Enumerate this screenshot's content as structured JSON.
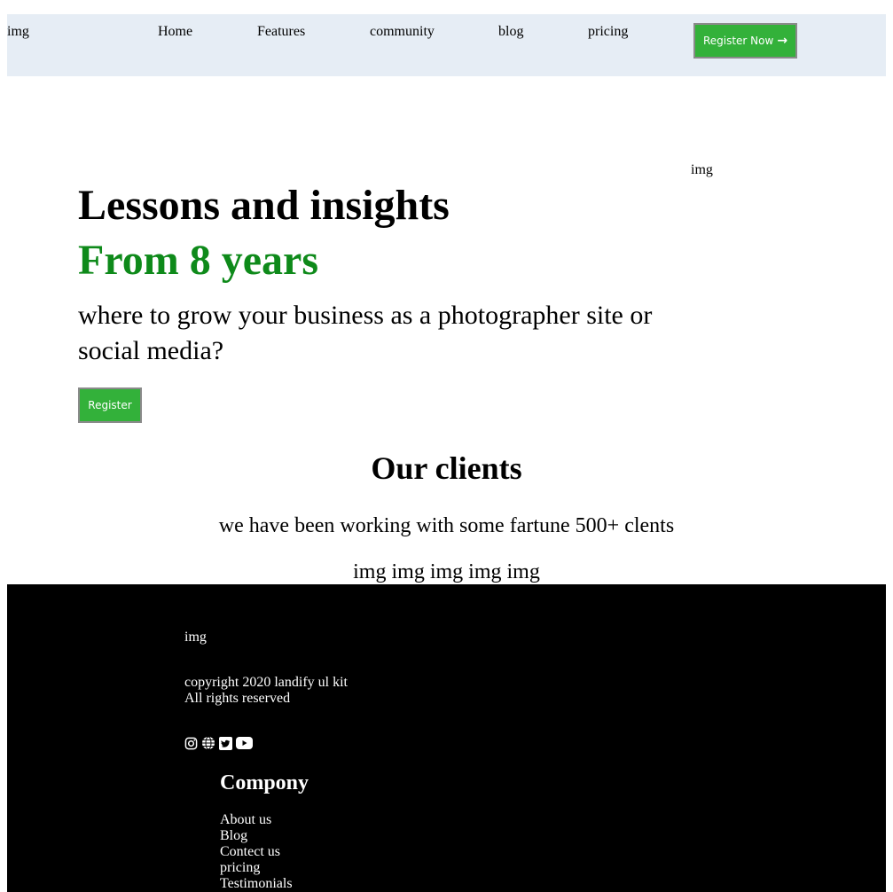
{
  "nav": {
    "logo": "img",
    "links": [
      "Home",
      "Features",
      "community",
      "blog",
      "pricing"
    ],
    "register_label": "Register Now",
    "register_icon": "arrow-right-icon"
  },
  "hero": {
    "image": "img",
    "title_line1": "Lessons and insights",
    "title_line2": "From 8 years",
    "subtitle": "where to grow your business as a photographer site or social media?",
    "button_label": "Register"
  },
  "clients": {
    "title": "Our clients",
    "subtitle": "we have been working with some fartune 500+ clents",
    "logos": [
      "img",
      "img",
      "img",
      "img",
      "img"
    ]
  },
  "footer": {
    "logo": "img",
    "copyright": "copyright 2020 landify ul kit",
    "rights": "All rights reserved",
    "social_icons": [
      "instagram-icon",
      "globe-icon",
      "twitter-icon",
      "youtube-icon"
    ],
    "company_title": "Compony",
    "company_links": [
      "About us",
      "Blog",
      "Contect us",
      "pricing",
      "Testimonials"
    ]
  },
  "colors": {
    "nav_bg": "#e6edf5",
    "button_green": "#33b13a",
    "accent_green": "#0e8a1a",
    "footer_bg": "#000000"
  }
}
